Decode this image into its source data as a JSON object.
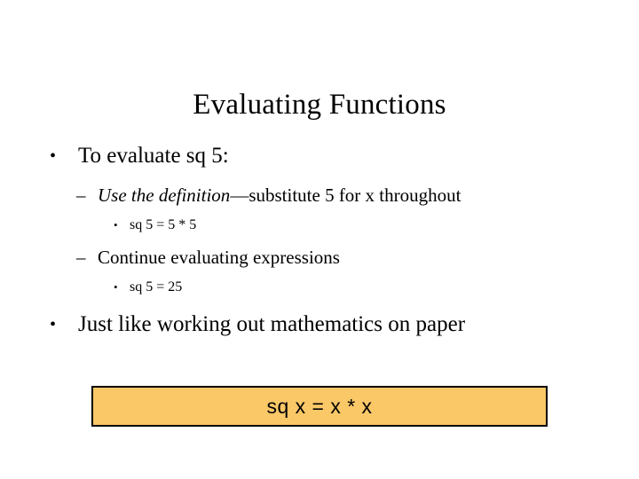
{
  "slide": {
    "title": "Evaluating Functions",
    "background_color": "#FFFFFF",
    "text_color": "#000000",
    "bullets": [
      {
        "level": 1,
        "marker": "•",
        "text": "To evaluate sq 5:"
      },
      {
        "level": 2,
        "marker": "–",
        "italic_text": "Use the definition",
        "roman_text": "—substitute 5 for x throughout"
      },
      {
        "level": 3,
        "marker": "•",
        "text": "sq 5 = 5 * 5"
      },
      {
        "level": 2,
        "marker": "–",
        "text": "Continue evaluating expressions"
      },
      {
        "level": 3,
        "marker": "•",
        "text": "sq 5 = 25"
      },
      {
        "level": 1,
        "marker": "•",
        "text": "Just like working out mathematics on paper"
      }
    ],
    "definition_box": {
      "text": "sq x = x * x",
      "fill_color": "#FBC868",
      "border_color": "#000000"
    }
  }
}
